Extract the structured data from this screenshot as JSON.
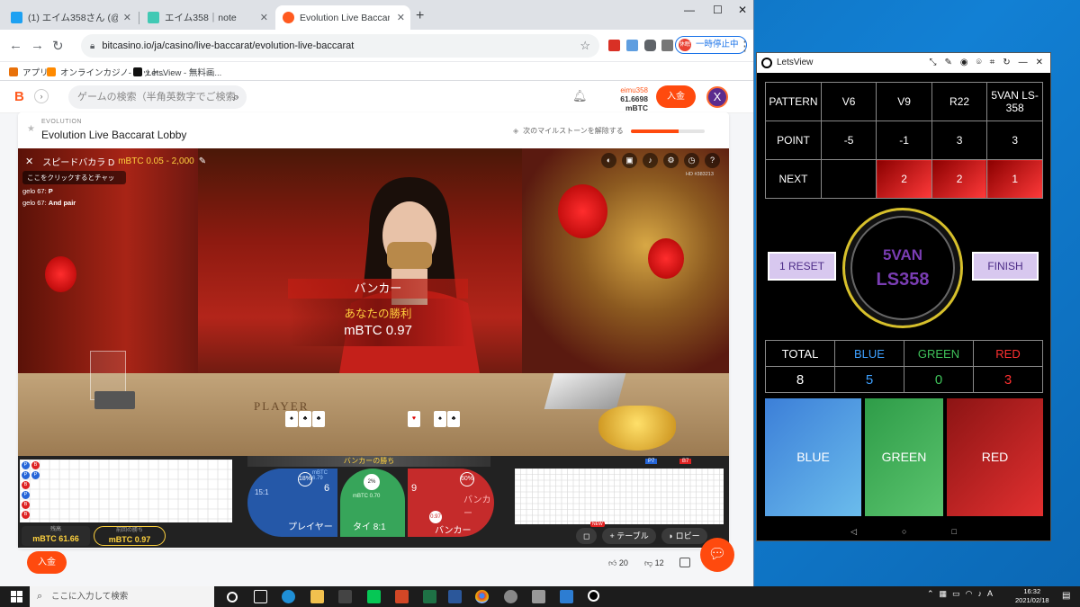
{
  "browser": {
    "tabs": [
      {
        "label": "(1) エイム358さん (@bzM0xnvXiN/",
        "icon_color": "#1da1f2"
      },
      {
        "label": "エイム358｜note",
        "icon_color": "#41c9b4"
      },
      {
        "label": "Evolution Live Baccarat Lobb",
        "icon_color": "#ff5a1f"
      }
    ],
    "new_tab": "+",
    "url": "bitcasino.io/ja/casino/live-baccarat/evolution-live-baccarat",
    "pause_label": "一時停止中",
    "profile_initials": "休眠",
    "bookmarks": [
      {
        "label": "アプリ",
        "icon_color": "#e8710a"
      },
      {
        "label": "オンラインカジノ- ビット...",
        "icon_color": "#ff8a00"
      },
      {
        "label": "LetsView - 無料画...",
        "icon_color": "#111111"
      }
    ]
  },
  "site": {
    "logo": "B",
    "search_placeholder": "ゲームの検索（半角英数字でご検索-",
    "username": "eimu358",
    "balance": "61.6698 mBTC",
    "deposit_label": "入金",
    "avatar_letter": "X",
    "provider": "EVOLUTION",
    "game_title": "Evolution Live Baccarat Lobby",
    "milestone_label": "次のマイルストーンを解除する",
    "milestone_progress": 0.65,
    "likes": "20",
    "dislikes": "12"
  },
  "game": {
    "table_name": "スピードバカラ D",
    "range": "mBTC 0.05 - 2,000",
    "chat_placeholder": "ここをクリックするとチャッ",
    "chat": [
      {
        "user": "gelo 67:",
        "msg": "P"
      },
      {
        "user": "gelo 67:",
        "msg": "And pair"
      }
    ],
    "hd_tag": "HD #383213",
    "win_side": "バンカー",
    "win_you": "あなたの勝利",
    "win_amount": "mBTC 0.97",
    "table_text": "PLAYER",
    "bet_strip": "バンカーの勝ち",
    "player_label": "プレイヤー",
    "tie_label": "タイ 8:1",
    "banker_label": "バンカー",
    "player_payout": "15:1",
    "player_score": "6",
    "banker_score": "9",
    "player_pct": "18%",
    "tie_pct": "2%",
    "banker_pct": "60%",
    "tie_amount": "mBTC 0.70",
    "player_amount": "mBTC 6.79",
    "banker_chip": "0.97",
    "balance_label": "残高",
    "balance_value": "mBTC 61.66",
    "lastwin_label": "前回の勝ち",
    "lastwin_value": "mBTC 0.97",
    "road_p": "P7",
    "road_b": "B7",
    "new_badge": "NEW",
    "table_btn": "テーブル",
    "lobby_btn": "ロビー"
  },
  "letsview": {
    "title": "LetsView",
    "pattern_table": {
      "headers": [
        "PATTERN",
        "V6",
        "V9",
        "R22",
        "5VAN LS-358"
      ],
      "point": [
        "POINT",
        "-5",
        "-1",
        "3",
        "3"
      ],
      "next": [
        "NEXT",
        "",
        "2",
        "2",
        "1"
      ]
    },
    "reset_label": "1 RESET",
    "finish_label": "FINISH",
    "ring_line1": "5VAN",
    "ring_line2": "LS358",
    "totals": {
      "headers": [
        "TOTAL",
        "BLUE",
        "GREEN",
        "RED"
      ],
      "values": [
        "8",
        "5",
        "0",
        "3"
      ],
      "colors": [
        "#ffffff",
        "#3ea0ff",
        "#3fc25a",
        "#ff3030"
      ]
    },
    "buttons": [
      "BLUE",
      "GREEN",
      "RED"
    ]
  },
  "taskbar": {
    "search_placeholder": "ここに入力して検索",
    "time": "16:32",
    "date": "2021/02/18"
  }
}
